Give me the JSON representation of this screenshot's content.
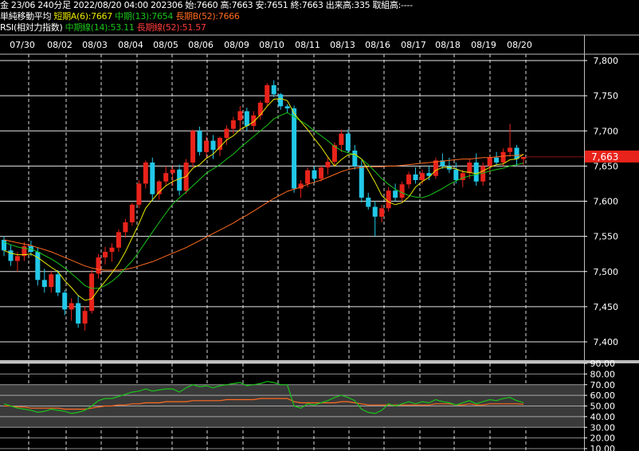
{
  "header": {
    "line1": "金 23/06 240分足 2022/08/20 04:00 202306 始:7660 高:7663 安:7651 終:7663 出来高:335 取組高:----",
    "ma_title": "単純移動平均",
    "ma_short": "短期A(6):7667",
    "ma_mid": "中期(13):7654",
    "ma_long": "長期B(52):7666",
    "rsi_title": "RSI(相対力指数)",
    "rsi_mid": "中期線(14):53.11",
    "rsi_long": "長期線(52):51.57"
  },
  "colors": {
    "up": "#e8231b",
    "down": "#22c8e8",
    "ma_short": "#e8e800",
    "ma_mid": "#19c419",
    "ma_long": "#ff6a1f",
    "price_tag": "#e8231b",
    "grid": "#ffffff",
    "separator": "#bdbdbd"
  },
  "chart_data": [
    {
      "type": "candlestick",
      "x_labels": [
        "07/30",
        "08/02",
        "08/03",
        "08/04",
        "08/05",
        "08/06",
        "08/09",
        "08/10",
        "08/11",
        "08/13",
        "08/16",
        "08/17",
        "08/18",
        "08/19",
        "08/20"
      ],
      "y_ticks": [
        "7,800",
        "7,750",
        "7,700",
        "7,650",
        "7,600",
        "7,550",
        "7,500",
        "7,450",
        "7,400"
      ],
      "ylim": [
        7375,
        7820
      ],
      "last_price": "7,663",
      "grid": true,
      "candles": [
        [
          7545,
          7550,
          7522,
          7530
        ],
        [
          7530,
          7538,
          7508,
          7515
        ],
        [
          7515,
          7528,
          7500,
          7522
        ],
        [
          7522,
          7542,
          7515,
          7536
        ],
        [
          7536,
          7544,
          7522,
          7528
        ],
        [
          7528,
          7534,
          7480,
          7488
        ],
        [
          7488,
          7504,
          7470,
          7478
        ],
        [
          7478,
          7500,
          7470,
          7496
        ],
        [
          7496,
          7502,
          7465,
          7470
        ],
        [
          7470,
          7474,
          7438,
          7446
        ],
        [
          7446,
          7462,
          7430,
          7455
        ],
        [
          7455,
          7466,
          7420,
          7426
        ],
        [
          7426,
          7450,
          7416,
          7444
        ],
        [
          7444,
          7502,
          7440,
          7497
        ],
        [
          7497,
          7525,
          7490,
          7520
        ],
        [
          7520,
          7535,
          7510,
          7528
        ],
        [
          7528,
          7540,
          7514,
          7534
        ],
        [
          7534,
          7560,
          7528,
          7556
        ],
        [
          7556,
          7575,
          7548,
          7570
        ],
        [
          7570,
          7598,
          7565,
          7595
        ],
        [
          7595,
          7630,
          7590,
          7625
        ],
        [
          7625,
          7658,
          7618,
          7655
        ],
        [
          7655,
          7662,
          7600,
          7610
        ],
        [
          7610,
          7630,
          7602,
          7628
        ],
        [
          7628,
          7650,
          7622,
          7640
        ],
        [
          7640,
          7650,
          7622,
          7645
        ],
        [
          7645,
          7652,
          7608,
          7615
        ],
        [
          7615,
          7660,
          7610,
          7655
        ],
        [
          7655,
          7702,
          7648,
          7700
        ],
        [
          7700,
          7706,
          7665,
          7670
        ],
        [
          7670,
          7692,
          7662,
          7686
        ],
        [
          7686,
          7694,
          7660,
          7673
        ],
        [
          7673,
          7692,
          7664,
          7690
        ],
        [
          7690,
          7708,
          7680,
          7703
        ],
        [
          7703,
          7720,
          7696,
          7715
        ],
        [
          7715,
          7735,
          7700,
          7728
        ],
        [
          7728,
          7733,
          7700,
          7707
        ],
        [
          7707,
          7728,
          7700,
          7722
        ],
        [
          7722,
          7743,
          7716,
          7740
        ],
        [
          7740,
          7768,
          7735,
          7765
        ],
        [
          7765,
          7772,
          7748,
          7752
        ],
        [
          7752,
          7754,
          7730,
          7735
        ],
        [
          7735,
          7738,
          7725,
          7732
        ],
        [
          7732,
          7736,
          7612,
          7618
        ],
        [
          7618,
          7630,
          7605,
          7625
        ],
        [
          7625,
          7648,
          7620,
          7644
        ],
        [
          7644,
          7650,
          7626,
          7632
        ],
        [
          7632,
          7650,
          7628,
          7648
        ],
        [
          7648,
          7662,
          7638,
          7656
        ],
        [
          7656,
          7684,
          7650,
          7680
        ],
        [
          7680,
          7702,
          7670,
          7696
        ],
        [
          7696,
          7702,
          7668,
          7672
        ],
        [
          7672,
          7680,
          7645,
          7650
        ],
        [
          7650,
          7658,
          7598,
          7605
        ],
        [
          7605,
          7612,
          7588,
          7592
        ],
        [
          7592,
          7600,
          7550,
          7578
        ],
        [
          7578,
          7595,
          7570,
          7590
        ],
        [
          7590,
          7620,
          7585,
          7615
        ],
        [
          7615,
          7625,
          7600,
          7605
        ],
        [
          7605,
          7628,
          7600,
          7624
        ],
        [
          7624,
          7642,
          7618,
          7638
        ],
        [
          7638,
          7648,
          7625,
          7630
        ],
        [
          7630,
          7645,
          7624,
          7640
        ],
        [
          7640,
          7650,
          7630,
          7636
        ],
        [
          7636,
          7662,
          7632,
          7658
        ],
        [
          7658,
          7668,
          7646,
          7650
        ],
        [
          7650,
          7662,
          7640,
          7645
        ],
        [
          7645,
          7655,
          7625,
          7630
        ],
        [
          7630,
          7645,
          7620,
          7640
        ],
        [
          7640,
          7660,
          7632,
          7655
        ],
        [
          7655,
          7668,
          7622,
          7628
        ],
        [
          7628,
          7655,
          7622,
          7650
        ],
        [
          7650,
          7665,
          7640,
          7662
        ],
        [
          7662,
          7670,
          7652,
          7655
        ],
        [
          7655,
          7675,
          7650,
          7670
        ],
        [
          7670,
          7710,
          7663,
          7676
        ],
        [
          7676,
          7680,
          7650,
          7660
        ],
        [
          7660,
          7663,
          7651,
          7663
        ]
      ],
      "ma_short": [
        7530,
        7526,
        7524,
        7524,
        7525,
        7520,
        7513,
        7506,
        7500,
        7487,
        7477,
        7466,
        7459,
        7461,
        7474,
        7486,
        7498,
        7511,
        7528,
        7548,
        7568,
        7590,
        7602,
        7613,
        7622,
        7628,
        7632,
        7635,
        7647,
        7652,
        7661,
        7667,
        7677,
        7687,
        7693,
        7702,
        7707,
        7713,
        7723,
        7735,
        7745,
        7746,
        7743,
        7725,
        7713,
        7702,
        7689,
        7677,
        7663,
        7650,
        7659,
        7666,
        7667,
        7660,
        7644,
        7627,
        7608,
        7599,
        7595,
        7598,
        7606,
        7620,
        7628,
        7634,
        7644,
        7648,
        7648,
        7646,
        7642,
        7641,
        7639,
        7643,
        7648,
        7652,
        7653,
        7659,
        7660,
        7667
      ],
      "ma_mid": [
        7542,
        7538,
        7535,
        7533,
        7532,
        7528,
        7523,
        7518,
        7512,
        7505,
        7497,
        7489,
        7480,
        7476,
        7476,
        7480,
        7486,
        7494,
        7505,
        7515,
        7528,
        7542,
        7556,
        7570,
        7583,
        7596,
        7605,
        7613,
        7622,
        7631,
        7640,
        7646,
        7652,
        7660,
        7667,
        7676,
        7684,
        7692,
        7700,
        7708,
        7717,
        7722,
        7726,
        7720,
        7714,
        7708,
        7700,
        7693,
        7686,
        7678,
        7672,
        7669,
        7666,
        7660,
        7652,
        7642,
        7632,
        7624,
        7617,
        7612,
        7608,
        7606,
        7605,
        7608,
        7613,
        7618,
        7624,
        7629,
        7633,
        7636,
        7638,
        7640,
        7643,
        7645,
        7647,
        7650,
        7652,
        7654
      ],
      "ma_long": [
        7545,
        7543,
        7541,
        7539,
        7537,
        7534,
        7531,
        7528,
        7524,
        7520,
        7516,
        7512,
        7508,
        7505,
        7503,
        7502,
        7502,
        7502,
        7503,
        7505,
        7508,
        7511,
        7514,
        7518,
        7522,
        7526,
        7530,
        7534,
        7539,
        7544,
        7549,
        7554,
        7559,
        7564,
        7569,
        7575,
        7580,
        7586,
        7592,
        7598,
        7604,
        7609,
        7614,
        7617,
        7620,
        7624,
        7627,
        7630,
        7634,
        7638,
        7642,
        7645,
        7647,
        7648,
        7649,
        7649,
        7649,
        7650,
        7650,
        7651,
        7652,
        7653,
        7654,
        7655,
        7656,
        7657,
        7658,
        7659,
        7660,
        7660,
        7661,
        7662,
        7662,
        7663,
        7664,
        7665,
        7665,
        7666
      ]
    },
    {
      "type": "line",
      "title": "RSI",
      "y_ticks": [
        "90.00",
        "80.00",
        "70.00",
        "60.00",
        "50.00",
        "40.00",
        "30.00",
        "20.00",
        "10.00"
      ],
      "ylim": [
        10,
        90
      ],
      "bands": [
        30,
        70
      ],
      "rsi_mid": [
        52,
        50,
        48,
        47,
        46,
        44,
        45,
        47,
        46,
        45,
        43,
        44,
        46,
        50,
        55,
        57,
        57,
        59,
        61,
        63,
        64,
        66,
        64,
        65,
        66,
        66,
        63,
        67,
        70,
        68,
        69,
        67,
        69,
        70,
        71,
        72,
        69,
        70,
        71,
        73,
        72,
        70,
        70,
        50,
        48,
        52,
        51,
        53,
        55,
        58,
        60,
        58,
        55,
        47,
        44,
        43,
        46,
        52,
        50,
        52,
        54,
        52,
        54,
        53,
        56,
        54,
        53,
        51,
        53,
        55,
        52,
        54,
        56,
        55,
        57,
        58,
        55,
        53.11
      ],
      "rsi_long": [
        50,
        50,
        49,
        49,
        48,
        48,
        48,
        48,
        48,
        47,
        47,
        47,
        47,
        48,
        49,
        50,
        50,
        51,
        51,
        52,
        52,
        53,
        53,
        53,
        54,
        54,
        54,
        54,
        55,
        55,
        55,
        55,
        55,
        56,
        56,
        56,
        56,
        56,
        57,
        57,
        57,
        57,
        57,
        54,
        53,
        53,
        53,
        53,
        53,
        53,
        54,
        54,
        53,
        52,
        51,
        51,
        51,
        51,
        51,
        51,
        51,
        51,
        51,
        51,
        52,
        52,
        52,
        51,
        51,
        52,
        51,
        51,
        52,
        52,
        52,
        52,
        52,
        51.57
      ]
    }
  ]
}
